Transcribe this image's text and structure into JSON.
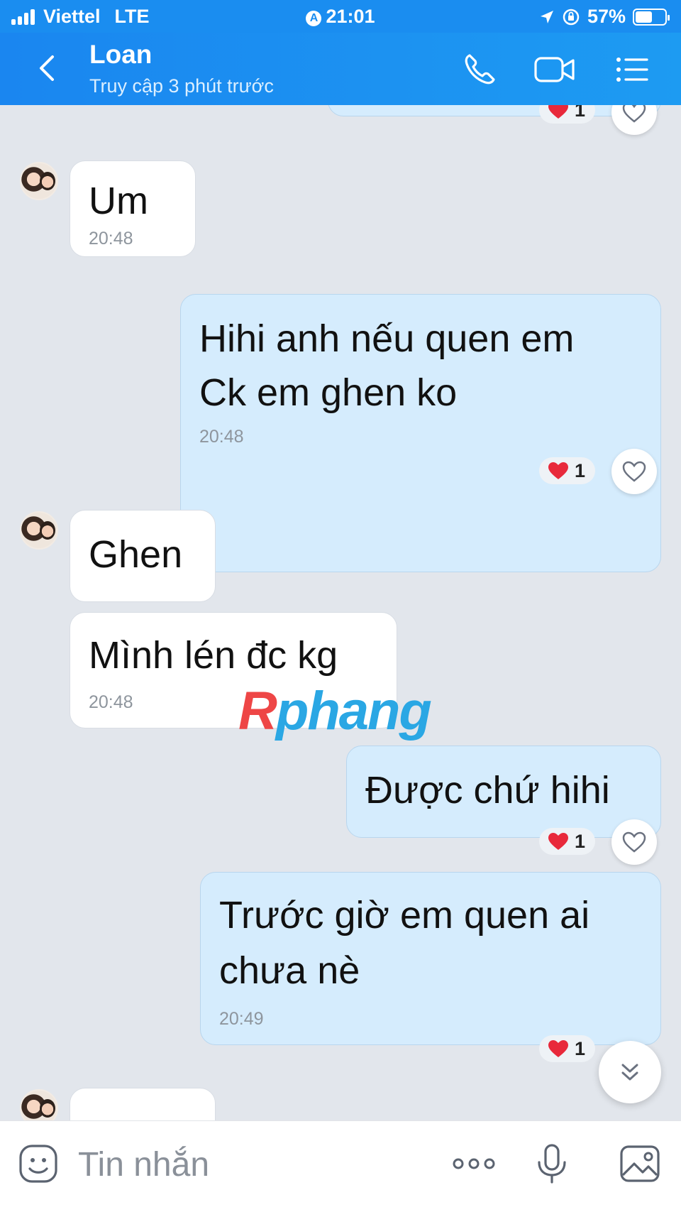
{
  "status_bar": {
    "carrier": "Viettel",
    "network": "LTE",
    "time": "21:01",
    "battery": "57%",
    "battery_level": 0.57
  },
  "header": {
    "contact_name": "Loan",
    "last_seen": "Truy cập 3 phút trước",
    "icons": [
      "back-icon",
      "phone-icon",
      "video-call-icon",
      "menu-list-icon"
    ]
  },
  "messages": [
    {
      "side": "in",
      "lines": [
        "Um"
      ],
      "time": "20:48"
    },
    {
      "side": "out",
      "lines": [
        "Hihi anh nếu quen em",
        "Ck em ghen ko"
      ],
      "time": "20:48",
      "reaction_count": "1"
    },
    {
      "side": "in",
      "lines": [
        "Ghen"
      ]
    },
    {
      "side": "in",
      "lines": [
        "Mình lén đc kg"
      ],
      "time": "20:48"
    },
    {
      "side": "out",
      "lines": [
        "Được chứ hihi"
      ],
      "reaction_count": "1"
    },
    {
      "side": "out",
      "lines": [
        "Trước giờ em quen ai",
        "chưa nè"
      ],
      "time": "20:49",
      "reaction_count": "1"
    }
  ],
  "top_reaction_count": "1",
  "watermark": {
    "first": "R",
    "rest": "phang"
  },
  "input_bar": {
    "placeholder": "Tin nhắn",
    "icons": [
      "sticker-icon",
      "more-icon",
      "microphone-icon",
      "image-icon"
    ]
  },
  "colors": {
    "header": "#1a8df0",
    "chat_bg": "#e2e6ec",
    "incoming_bubble": "#ffffff",
    "outgoing_bubble": "#d5ecfd",
    "heart": "#e8293b"
  }
}
